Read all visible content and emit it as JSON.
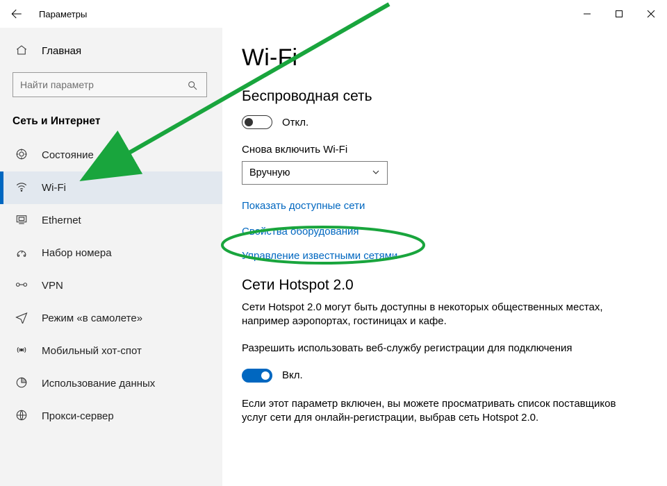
{
  "titlebar": {
    "title": "Параметры"
  },
  "sidebar": {
    "home_label": "Главная",
    "search_placeholder": "Найти параметр",
    "section_title": "Сеть и Интернет",
    "items": [
      {
        "id": "status",
        "label": "Состояние",
        "icon": "status",
        "selected": false
      },
      {
        "id": "wifi",
        "label": "Wi-Fi",
        "icon": "wifi",
        "selected": true
      },
      {
        "id": "ethernet",
        "label": "Ethernet",
        "icon": "ethernet",
        "selected": false
      },
      {
        "id": "dialup",
        "label": "Набор номера",
        "icon": "dialup",
        "selected": false
      },
      {
        "id": "vpn",
        "label": "VPN",
        "icon": "vpn",
        "selected": false
      },
      {
        "id": "airplane",
        "label": "Режим «в самолете»",
        "icon": "airplane",
        "selected": false
      },
      {
        "id": "hotspot",
        "label": "Мобильный хот-спот",
        "icon": "hotspot",
        "selected": false
      },
      {
        "id": "datausage",
        "label": "Использование данных",
        "icon": "datausage",
        "selected": false
      },
      {
        "id": "proxy",
        "label": "Прокси-сервер",
        "icon": "proxy",
        "selected": false
      }
    ]
  },
  "main": {
    "page_title": "Wi-Fi",
    "wireless": {
      "heading": "Беспроводная сеть",
      "toggle_state": "off",
      "toggle_label": "Откл.",
      "reenable_label": "Снова включить Wi-Fi",
      "reenable_select": {
        "value": "Вручную"
      }
    },
    "links": {
      "available": "Показать доступные сети",
      "hw_props": "Свойства оборудования",
      "known_nets": "Управление известными сетями"
    },
    "hotspot2": {
      "heading": "Сети Hotspot 2.0",
      "desc1": "Сети Hotspot 2.0 могут быть доступны в некоторых общественных местах, например аэропортах, гостиницах и кафе.",
      "allow_label": "Разрешить использовать веб-службу регистрации для подключения",
      "toggle_state": "on",
      "toggle_label": "Вкл.",
      "desc2": "Если этот параметр включен, вы можете просматривать список поставщиков услуг сети для онлайн-регистрации, выбрав сеть Hotspot 2.0."
    }
  },
  "annotation": {
    "color": "#19a53d"
  }
}
